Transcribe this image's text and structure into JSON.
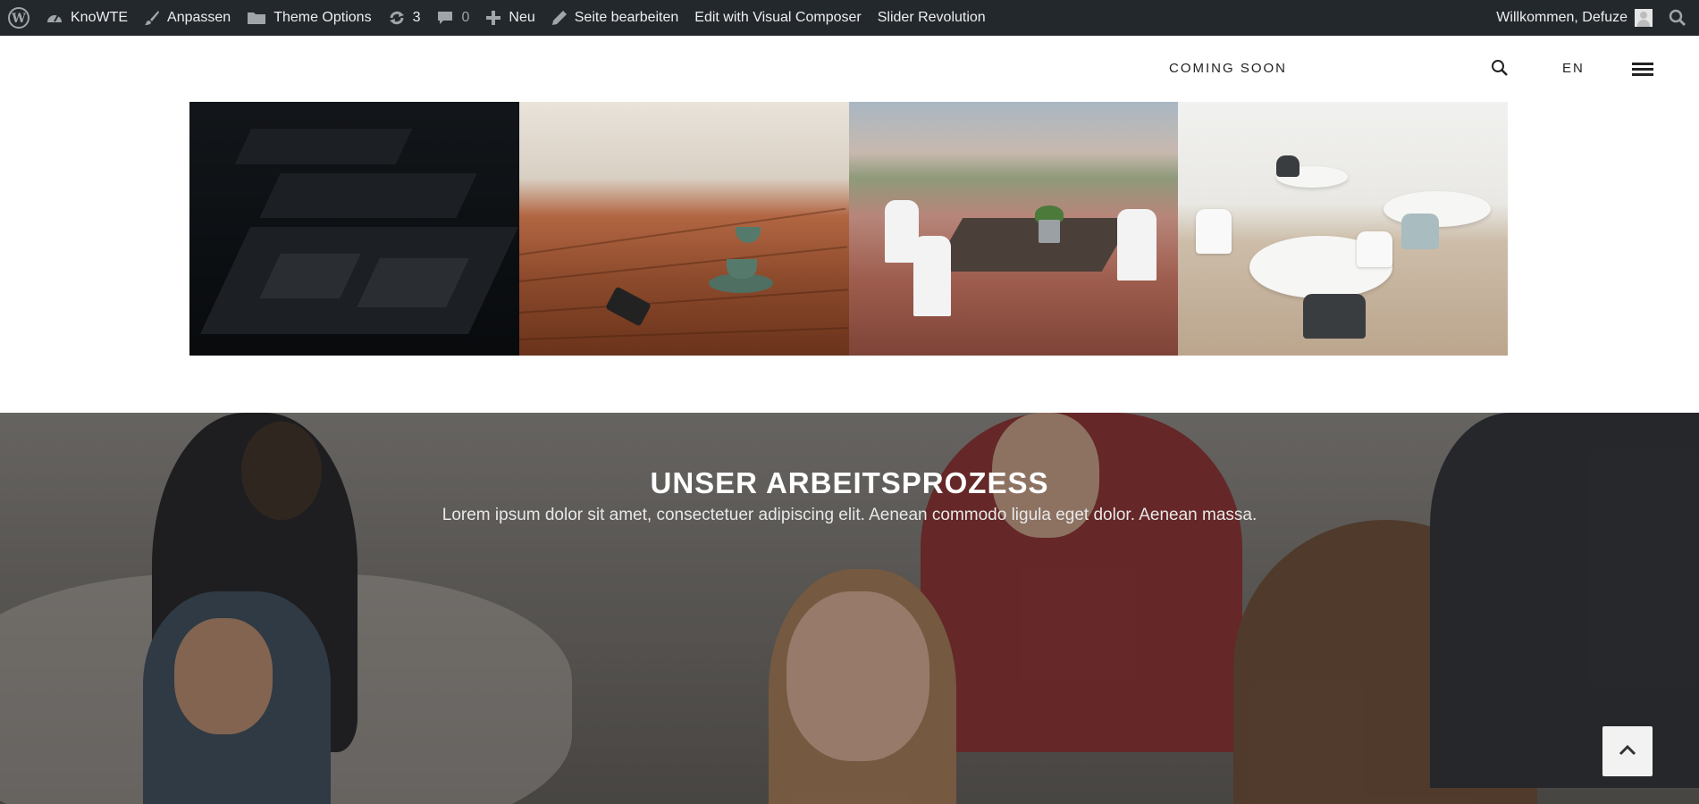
{
  "adminbar": {
    "site_name": "KnoWTE",
    "customize": "Anpassen",
    "theme_options": "Theme Options",
    "updates_count": "3",
    "comments_count": "0",
    "new_label": "Neu",
    "edit_page": "Seite bearbeiten",
    "visual_composer": "Edit with Visual Composer",
    "slider_revolution": "Slider Revolution",
    "welcome": "Willkommen, Defuze"
  },
  "header": {
    "nav_coming_soon": "COMING SOON",
    "lang": "EN",
    "icons": {
      "search": "search-icon",
      "menu": "hamburger-menu-icon"
    }
  },
  "gallery": {
    "tiles": [
      "restaurant-dark-photo",
      "wooden-table-coffee-photo",
      "outdoor-cafe-photo",
      "white-cafe-interior-photo"
    ]
  },
  "process": {
    "title": "UNSER ARBEITSPROZESS",
    "subtitle": "Lorem ipsum dolor sit amet, consectetuer adipiscing elit. Aenean commodo ligula eget dolor. Aenean massa.",
    "background": "team-meeting-photo"
  },
  "back_to_top": {
    "icon": "chevron-up-icon"
  },
  "colors": {
    "adminbar_bg": "#23282d",
    "adminbar_text": "#eeeeee",
    "accent_text": "#222222"
  }
}
